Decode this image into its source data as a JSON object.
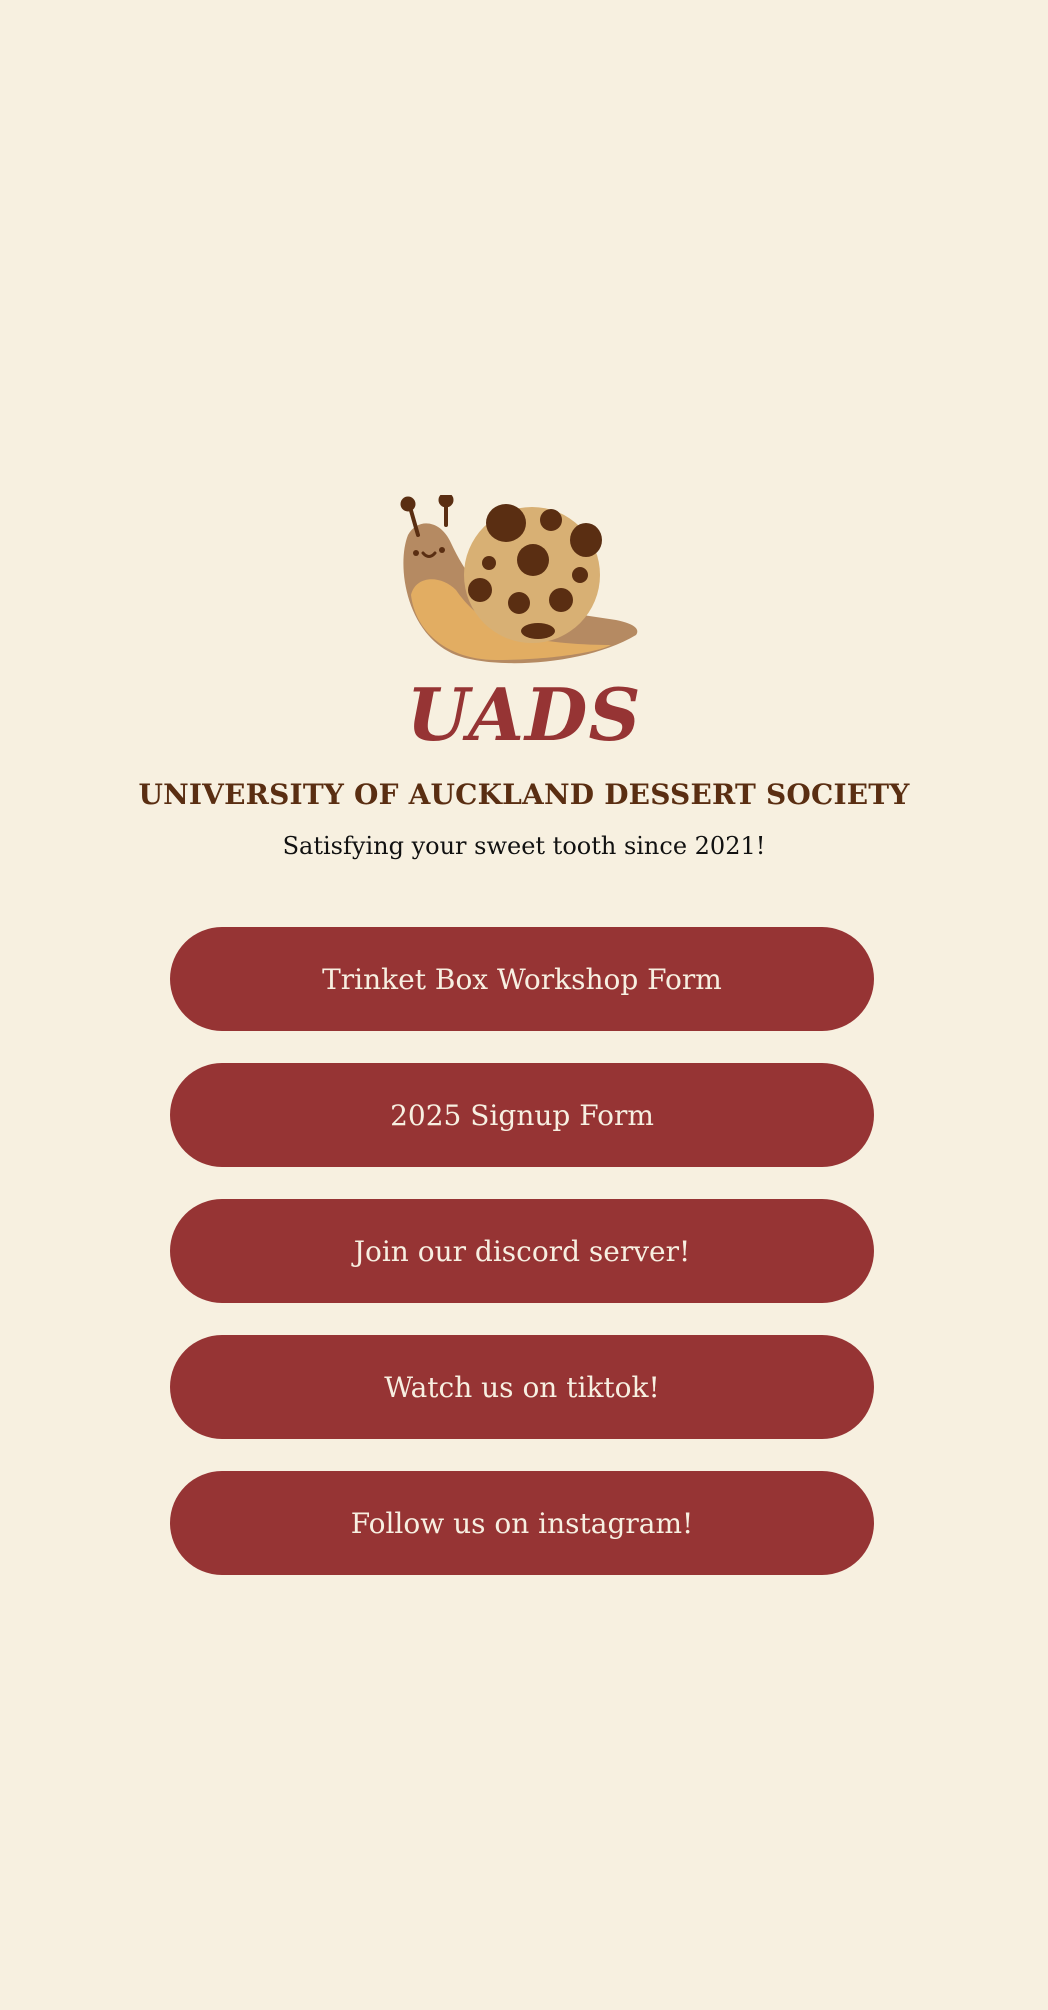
{
  "header": {
    "logo_icon": "snail-cookie-logo-icon",
    "brand": "UADS",
    "society_name": "UNIVERSITY OF AUCKLAND DESSERT SOCIETY",
    "tagline": "Satisfying your sweet tooth since 2021!"
  },
  "links": [
    {
      "label": "Trinket Box Workshop Form"
    },
    {
      "label": "2025 Signup Form"
    },
    {
      "label": "Join our discord server!"
    },
    {
      "label": "Watch us on tiktok!"
    },
    {
      "label": "Follow us on instagram!"
    }
  ],
  "colors": {
    "background": "#f7f0e0",
    "button": "#963434",
    "button_text": "#f7efe1",
    "heading": "#5a2e12",
    "brand": "#963434"
  }
}
